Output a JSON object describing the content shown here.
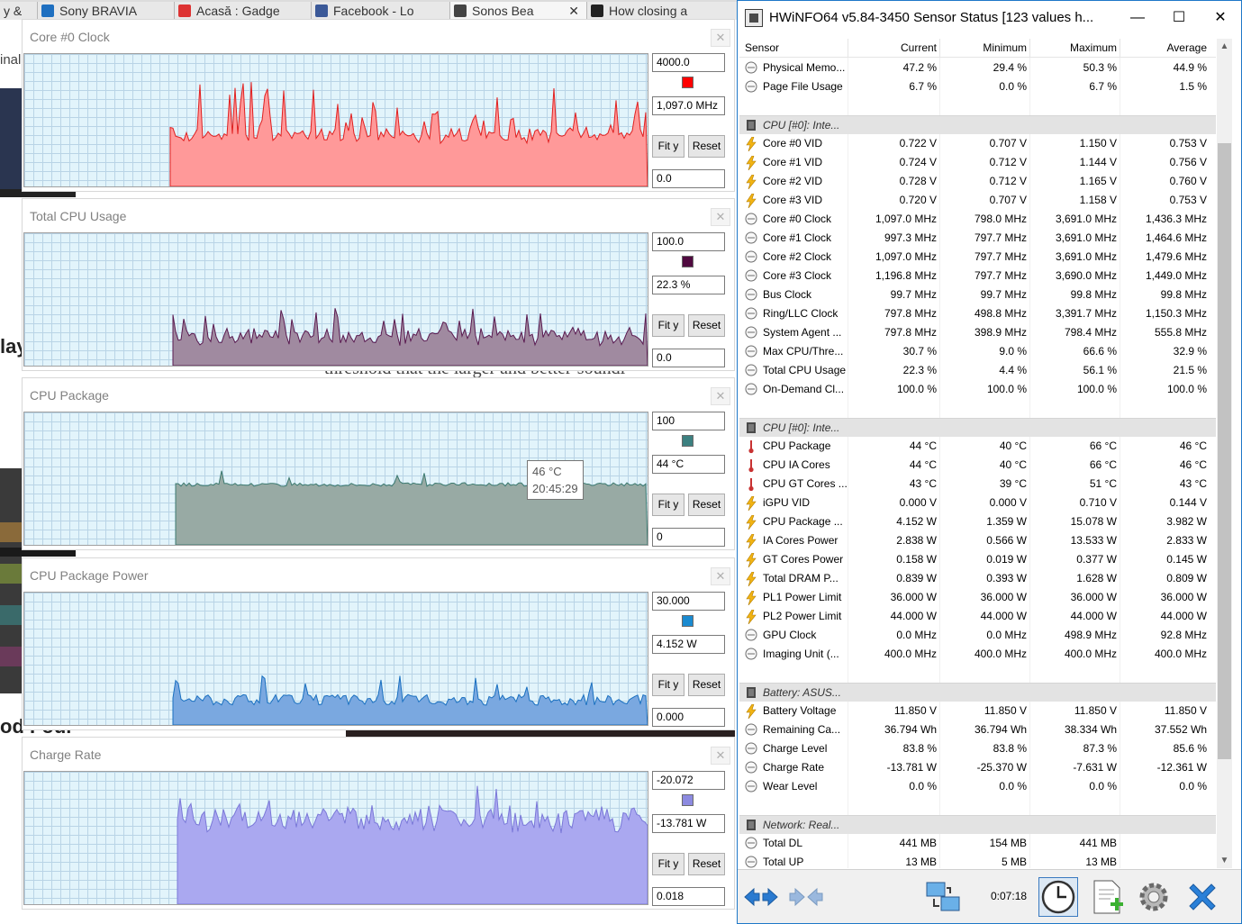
{
  "browser": {
    "tabs": [
      {
        "label": "y &",
        "fav": ""
      },
      {
        "label": "Sony BRAVIA",
        "fav": "#1e6fc0"
      },
      {
        "label": "Acasă : Gadge",
        "fav": "#d33"
      },
      {
        "label": "Facebook - Lo",
        "fav": "#3b5998"
      },
      {
        "label": "Sonos Bea",
        "fav": "#444"
      },
      {
        "label": "How closing a",
        "fav": "#222"
      }
    ],
    "tab_close_glyph": "✕",
    "fragments": {
      "inal": "inal",
      "lay": "lay",
      "threshold": "threshold that the larger and better-soundi",
      "od_four": "od Four"
    }
  },
  "graphs": [
    {
      "title": "Core #0 Clock",
      "max": "4000.0",
      "current": "1,097.0 MHz",
      "min": "0.0",
      "color": "#ff0000",
      "fill": "#ff9999",
      "stroke": "#e02020",
      "fit_label": "Fit y",
      "reset_label": "Reset",
      "close": "✕"
    },
    {
      "title": "Total CPU Usage",
      "max": "100.0",
      "current": "22.3 %",
      "min": "0.0",
      "color": "#500a40",
      "fill": "#a08aa0",
      "stroke": "#5a1a50",
      "fit_label": "Fit y",
      "reset_label": "Reset",
      "close": "✕"
    },
    {
      "title": "CPU Package",
      "max": "100",
      "current": "44 °C",
      "min": "0",
      "color": "#3c8080",
      "fill": "#98aaa4",
      "stroke": "#3c7a70",
      "fit_label": "Fit y",
      "reset_label": "Reset",
      "close": "✕",
      "tooltip": {
        "value": "46 °C",
        "time": "20:45:29"
      }
    },
    {
      "title": "CPU Package Power",
      "max": "30.000",
      "current": "4.152 W",
      "min": "0.000",
      "color": "#1a8ad0",
      "fill": "#7aa8e0",
      "stroke": "#1a70c0",
      "fit_label": "Fit y",
      "reset_label": "Reset",
      "close": "✕"
    },
    {
      "title": "Charge Rate",
      "max": "-20.072",
      "current": "-13.781 W",
      "min": "0.018",
      "color": "#8c8ae0",
      "fill": "#aaa8f0",
      "stroke": "#7a78d8",
      "fit_label": "Fit y",
      "reset_label": "Reset",
      "close": "✕"
    }
  ],
  "hwinfo": {
    "title": "HWiNFO64 v5.84-3450 Sensor Status [123 values h...",
    "controls": {
      "minimize": "—",
      "maximize": "☐",
      "close": "✕"
    },
    "columns": [
      "Sensor",
      "Current",
      "Minimum",
      "Maximum",
      "Average"
    ],
    "rows": [
      {
        "type": "s",
        "icon": "clock",
        "name": "Physical Memo...",
        "v": [
          "47.2 %",
          "29.4 %",
          "50.3 %",
          "44.9 %"
        ]
      },
      {
        "type": "s",
        "icon": "clock",
        "name": "Page File Usage",
        "v": [
          "6.7 %",
          "0.0 %",
          "6.7 %",
          "1.5 %"
        ]
      },
      {
        "type": "blank"
      },
      {
        "type": "g",
        "name": "CPU [#0]: Inte..."
      },
      {
        "type": "s",
        "icon": "bolt",
        "name": "Core #0 VID",
        "v": [
          "0.722 V",
          "0.707 V",
          "1.150 V",
          "0.753 V"
        ]
      },
      {
        "type": "s",
        "icon": "bolt",
        "name": "Core #1 VID",
        "v": [
          "0.724 V",
          "0.712 V",
          "1.144 V",
          "0.756 V"
        ]
      },
      {
        "type": "s",
        "icon": "bolt",
        "name": "Core #2 VID",
        "v": [
          "0.728 V",
          "0.712 V",
          "1.165 V",
          "0.760 V"
        ]
      },
      {
        "type": "s",
        "icon": "bolt",
        "name": "Core #3 VID",
        "v": [
          "0.720 V",
          "0.707 V",
          "1.158 V",
          "0.753 V"
        ]
      },
      {
        "type": "s",
        "icon": "clock",
        "name": "Core #0 Clock",
        "v": [
          "1,097.0 MHz",
          "798.0 MHz",
          "3,691.0 MHz",
          "1,436.3 MHz"
        ]
      },
      {
        "type": "s",
        "icon": "clock",
        "name": "Core #1 Clock",
        "v": [
          "997.3 MHz",
          "797.7 MHz",
          "3,691.0 MHz",
          "1,464.6 MHz"
        ]
      },
      {
        "type": "s",
        "icon": "clock",
        "name": "Core #2 Clock",
        "v": [
          "1,097.0 MHz",
          "797.7 MHz",
          "3,691.0 MHz",
          "1,479.6 MHz"
        ]
      },
      {
        "type": "s",
        "icon": "clock",
        "name": "Core #3 Clock",
        "v": [
          "1,196.8 MHz",
          "797.7 MHz",
          "3,690.0 MHz",
          "1,449.0 MHz"
        ]
      },
      {
        "type": "s",
        "icon": "clock",
        "name": "Bus Clock",
        "v": [
          "99.7 MHz",
          "99.7 MHz",
          "99.8 MHz",
          "99.8 MHz"
        ]
      },
      {
        "type": "s",
        "icon": "clock",
        "name": "Ring/LLC Clock",
        "v": [
          "797.8 MHz",
          "498.8 MHz",
          "3,391.7 MHz",
          "1,150.3 MHz"
        ]
      },
      {
        "type": "s",
        "icon": "clock",
        "name": "System Agent ...",
        "v": [
          "797.8 MHz",
          "398.9 MHz",
          "798.4 MHz",
          "555.8 MHz"
        ]
      },
      {
        "type": "s",
        "icon": "clock",
        "name": "Max CPU/Thre...",
        "v": [
          "30.7 %",
          "9.0 %",
          "66.6 %",
          "32.9 %"
        ]
      },
      {
        "type": "s",
        "icon": "clock",
        "name": "Total CPU Usage",
        "v": [
          "22.3 %",
          "4.4 %",
          "56.1 %",
          "21.5 %"
        ]
      },
      {
        "type": "s",
        "icon": "clock",
        "name": "On-Demand Cl...",
        "v": [
          "100.0 %",
          "100.0 %",
          "100.0 %",
          "100.0 %"
        ]
      },
      {
        "type": "blank"
      },
      {
        "type": "g",
        "name": "CPU [#0]: Inte..."
      },
      {
        "type": "s",
        "icon": "therm",
        "name": "CPU Package",
        "v": [
          "44 °C",
          "40 °C",
          "66 °C",
          "46 °C"
        ]
      },
      {
        "type": "s",
        "icon": "therm",
        "name": "CPU IA Cores",
        "v": [
          "44 °C",
          "40 °C",
          "66 °C",
          "46 °C"
        ]
      },
      {
        "type": "s",
        "icon": "therm",
        "name": "CPU GT Cores ...",
        "v": [
          "43 °C",
          "39 °C",
          "51 °C",
          "43 °C"
        ]
      },
      {
        "type": "s",
        "icon": "bolt",
        "name": "iGPU VID",
        "v": [
          "0.000 V",
          "0.000 V",
          "0.710 V",
          "0.144 V"
        ]
      },
      {
        "type": "s",
        "icon": "bolt",
        "name": "CPU Package ...",
        "v": [
          "4.152 W",
          "1.359 W",
          "15.078 W",
          "3.982 W"
        ]
      },
      {
        "type": "s",
        "icon": "bolt",
        "name": "IA Cores Power",
        "v": [
          "2.838 W",
          "0.566 W",
          "13.533 W",
          "2.833 W"
        ]
      },
      {
        "type": "s",
        "icon": "bolt",
        "name": "GT Cores Power",
        "v": [
          "0.158 W",
          "0.019 W",
          "0.377 W",
          "0.145 W"
        ]
      },
      {
        "type": "s",
        "icon": "bolt",
        "name": "Total DRAM P...",
        "v": [
          "0.839 W",
          "0.393 W",
          "1.628 W",
          "0.809 W"
        ]
      },
      {
        "type": "s",
        "icon": "bolt",
        "name": "PL1 Power Limit",
        "v": [
          "36.000 W",
          "36.000 W",
          "36.000 W",
          "36.000 W"
        ]
      },
      {
        "type": "s",
        "icon": "bolt",
        "name": "PL2 Power Limit",
        "v": [
          "44.000 W",
          "44.000 W",
          "44.000 W",
          "44.000 W"
        ]
      },
      {
        "type": "s",
        "icon": "clock",
        "name": "GPU Clock",
        "v": [
          "0.0 MHz",
          "0.0 MHz",
          "498.9 MHz",
          "92.8 MHz"
        ]
      },
      {
        "type": "s",
        "icon": "clock",
        "name": "Imaging Unit (...",
        "v": [
          "400.0 MHz",
          "400.0 MHz",
          "400.0 MHz",
          "400.0 MHz"
        ]
      },
      {
        "type": "blank"
      },
      {
        "type": "g",
        "name": "Battery: ASUS..."
      },
      {
        "type": "s",
        "icon": "bolt",
        "name": "Battery Voltage",
        "v": [
          "11.850 V",
          "11.850 V",
          "11.850 V",
          "11.850 V"
        ]
      },
      {
        "type": "s",
        "icon": "clock",
        "name": "Remaining Ca...",
        "v": [
          "36.794 Wh",
          "36.794 Wh",
          "38.334 Wh",
          "37.552 Wh"
        ]
      },
      {
        "type": "s",
        "icon": "clock",
        "name": "Charge Level",
        "v": [
          "83.8 %",
          "83.8 %",
          "87.3 %",
          "85.6 %"
        ]
      },
      {
        "type": "s",
        "icon": "clock",
        "name": "Charge Rate",
        "v": [
          "-13.781 W",
          "-25.370 W",
          "-7.631 W",
          "-12.361 W"
        ]
      },
      {
        "type": "s",
        "icon": "clock",
        "name": "Wear Level",
        "v": [
          "0.0 %",
          "0.0 %",
          "0.0 %",
          "0.0 %"
        ]
      },
      {
        "type": "blank"
      },
      {
        "type": "g",
        "name": "Network: Real..."
      },
      {
        "type": "s",
        "icon": "clock",
        "name": "Total DL",
        "v": [
          "441 MB",
          "154 MB",
          "441 MB",
          ""
        ]
      },
      {
        "type": "s",
        "icon": "clock",
        "name": "Total UP",
        "v": [
          "13 MB",
          "5 MB",
          "13 MB",
          ""
        ]
      }
    ],
    "scroll": {
      "up": "▲",
      "down": "▼"
    },
    "timer": "0:07:18",
    "toolbar_icons": [
      "expand-arrows-icon",
      "collapse-arrows-icon",
      "network-computers-icon",
      "clock-icon",
      "report-add-icon",
      "settings-gear-icon",
      "close-x-icon"
    ]
  }
}
